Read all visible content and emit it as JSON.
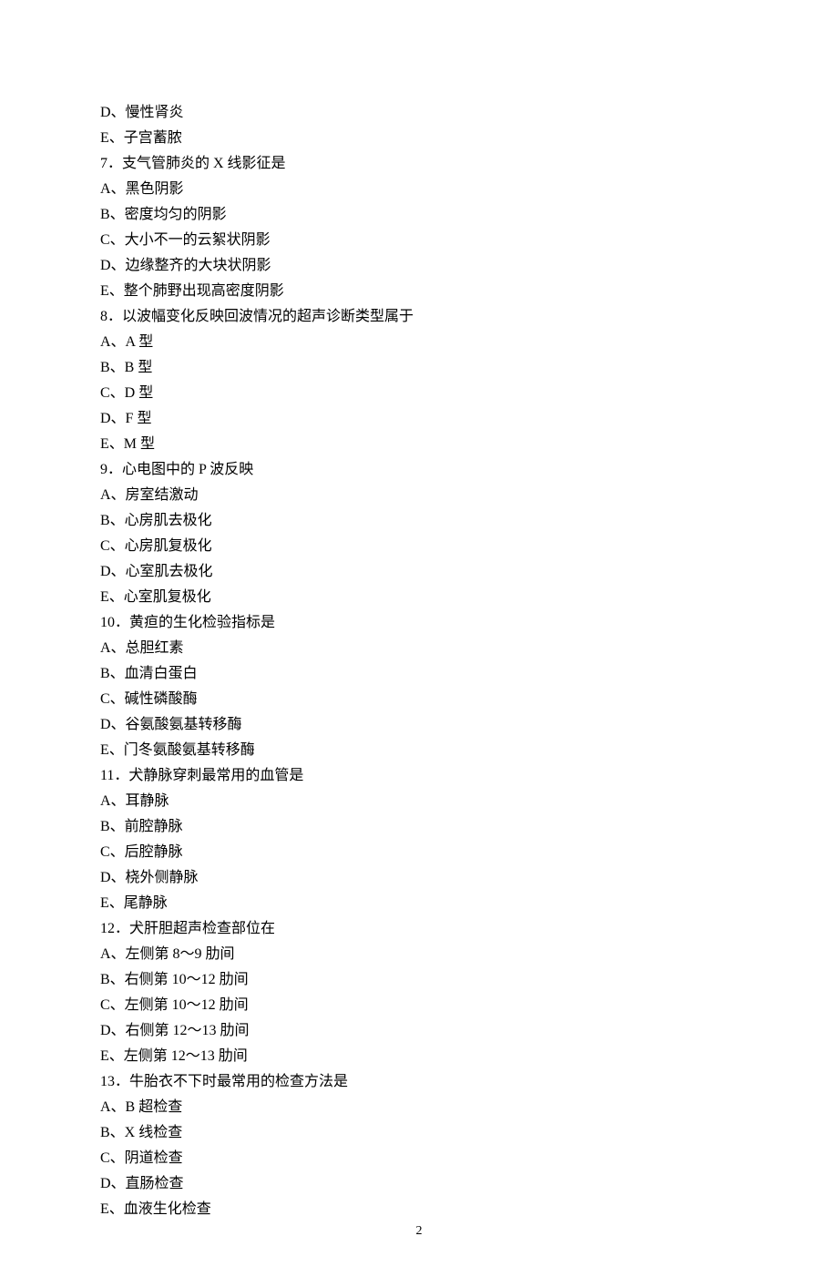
{
  "lines": [
    "D、慢性肾炎",
    "E、子宫蓄脓",
    "7．支气管肺炎的 X 线影征是",
    "A、黑色阴影",
    "B、密度均匀的阴影",
    "C、大小不一的云絮状阴影",
    "D、边缘整齐的大块状阴影",
    "E、整个肺野出现高密度阴影",
    "8．以波幅变化反映回波情况的超声诊断类型属于",
    "A、A 型",
    "B、B 型",
    "C、D 型",
    "D、F 型",
    "E、M 型",
    "9．心电图中的 P 波反映",
    "A、房室结激动",
    "B、心房肌去极化",
    "C、心房肌复极化",
    "D、心室肌去极化",
    "E、心室肌复极化",
    "10．黄疸的生化检验指标是",
    "A、总胆红素",
    "B、血清白蛋白",
    "C、碱性磷酸酶",
    "D、谷氨酸氨基转移酶",
    "E、门冬氨酸氨基转移酶",
    "11．犬静脉穿刺最常用的血管是",
    "A、耳静脉",
    "B、前腔静脉",
    "C、后腔静脉",
    "D、桡外侧静脉",
    "E、尾静脉",
    "12．犬肝胆超声检查部位在",
    "A、左侧第 8～9 肋间",
    "B、右侧第 10～12 肋间",
    "C、左侧第 10～12 肋间",
    "D、右侧第 12～13 肋间",
    "E、左侧第 12～13 肋间",
    "13．牛胎衣不下时最常用的检查方法是",
    "A、B 超检查",
    "B、X 线检查",
    "C、阴道检查",
    "D、直肠检查",
    "E、血液生化检查"
  ],
  "page_number": "2"
}
